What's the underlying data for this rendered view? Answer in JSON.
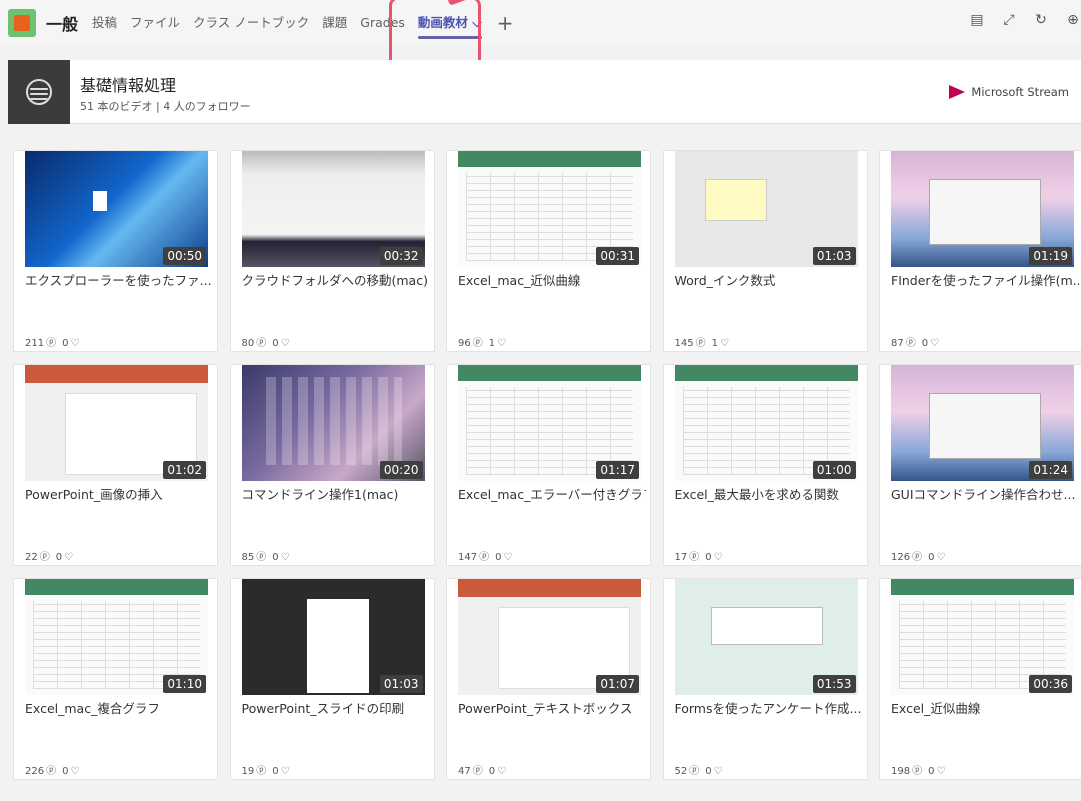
{
  "topbar": {
    "channel": "一般",
    "tabs": [
      "投稿",
      "ファイル",
      "クラス ノートブック",
      "課題",
      "Grades"
    ],
    "active_tab": "動画教材 ⌵",
    "plus": "+"
  },
  "header": {
    "title": "基礎情報処理",
    "subtitle": "51 本のビデオ | 4 人のフォロワー",
    "stream_label": "Microsoft Stream"
  },
  "icons": {
    "views": "view-icon",
    "likes": "heart-icon",
    "right": [
      "chat-icon",
      "expand-icon",
      "refresh-icon",
      "globe-icon"
    ]
  },
  "videos": [
    {
      "title": "エクスプローラーを使ったファ...",
      "duration": "00:50",
      "views": "211",
      "likes": "0",
      "thumb": "t-win"
    },
    {
      "title": "クラウドフォルダへの移動(mac)",
      "duration": "00:32",
      "views": "80",
      "likes": "0",
      "thumb": "t-mac"
    },
    {
      "title": "Excel_mac_近似曲線",
      "duration": "00:31",
      "views": "96",
      "likes": "1",
      "thumb": "t-excel"
    },
    {
      "title": "Word_インク数式",
      "duration": "01:03",
      "views": "145",
      "likes": "1",
      "thumb": "t-word"
    },
    {
      "title": "FInderを使ったファイル操作(m...",
      "duration": "01:19",
      "views": "87",
      "likes": "0",
      "thumb": "t-finder"
    },
    {
      "title": "PowerPoint_画像の挿入",
      "duration": "01:02",
      "views": "22",
      "likes": "0",
      "thumb": "t-ppt"
    },
    {
      "title": "コマンドライン操作1(mac)",
      "duration": "00:20",
      "views": "85",
      "likes": "0",
      "thumb": "t-launch"
    },
    {
      "title": "Excel_mac_エラーバー付きグラフ",
      "duration": "01:17",
      "views": "147",
      "likes": "0",
      "thumb": "t-excel"
    },
    {
      "title": "Excel_最大最小を求める関数",
      "duration": "01:00",
      "views": "17",
      "likes": "0",
      "thumb": "t-excel"
    },
    {
      "title": "GUIコマンドライン操作合わせ...",
      "duration": "01:24",
      "views": "126",
      "likes": "0",
      "thumb": "t-finder"
    },
    {
      "title": "Excel_mac_複合グラフ",
      "duration": "01:10",
      "views": "226",
      "likes": "0",
      "thumb": "t-excel"
    },
    {
      "title": "PowerPoint_スライドの印刷",
      "duration": "01:03",
      "views": "19",
      "likes": "0",
      "thumb": "t-dark"
    },
    {
      "title": "PowerPoint_テキストボックス",
      "duration": "01:07",
      "views": "47",
      "likes": "0",
      "thumb": "t-ppt"
    },
    {
      "title": "Formsを使ったアンケート作成...",
      "duration": "01:53",
      "views": "52",
      "likes": "0",
      "thumb": "t-forms"
    },
    {
      "title": "Excel_近似曲線",
      "duration": "00:36",
      "views": "198",
      "likes": "0",
      "thumb": "t-excel"
    }
  ]
}
